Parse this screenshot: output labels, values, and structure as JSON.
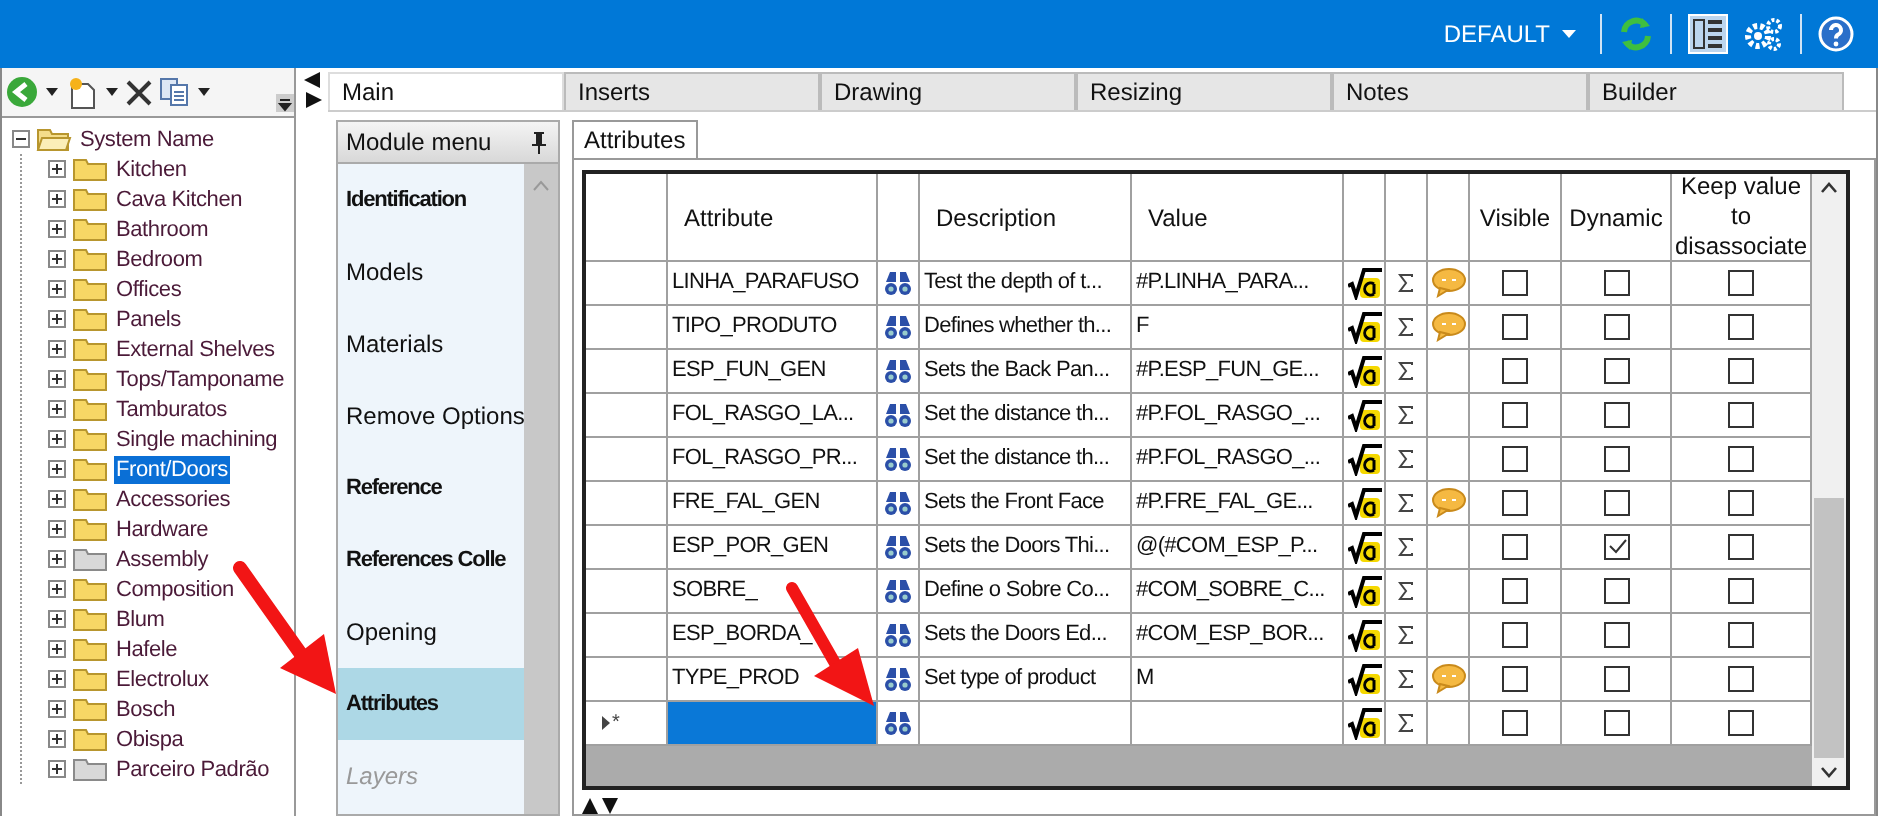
{
  "top_bar": {
    "profile": "DEFAULT"
  },
  "tree": {
    "label": "System Name",
    "expanded": true,
    "children": [
      {
        "label": "Kitchen",
        "kind": "folder",
        "selected": false
      },
      {
        "label": "Cava Kitchen",
        "kind": "folder",
        "selected": false
      },
      {
        "label": "Bathroom",
        "kind": "folder",
        "selected": false
      },
      {
        "label": "Bedroom",
        "kind": "folder",
        "selected": false
      },
      {
        "label": "Offices",
        "kind": "folder",
        "selected": false
      },
      {
        "label": "Panels",
        "kind": "folder",
        "selected": false
      },
      {
        "label": "External Shelves",
        "kind": "folder",
        "selected": false
      },
      {
        "label": "Tops/Tamponame",
        "kind": "folder",
        "selected": false
      },
      {
        "label": "Tamburatos",
        "kind": "folder",
        "selected": false
      },
      {
        "label": "Single machining",
        "kind": "folder",
        "selected": false
      },
      {
        "label": "Front/Doors",
        "kind": "folder",
        "selected": true
      },
      {
        "label": "Accessories",
        "kind": "folder",
        "selected": false
      },
      {
        "label": "Hardware",
        "kind": "folder",
        "selected": false
      },
      {
        "label": "Assembly",
        "kind": "grey",
        "selected": false
      },
      {
        "label": "Composition",
        "kind": "folder",
        "selected": false
      },
      {
        "label": "Blum",
        "kind": "folder",
        "selected": false
      },
      {
        "label": "Hafele",
        "kind": "folder",
        "selected": false
      },
      {
        "label": "Electrolux",
        "kind": "folder",
        "selected": false
      },
      {
        "label": "Bosch",
        "kind": "folder",
        "selected": false
      },
      {
        "label": "Obispa",
        "kind": "folder",
        "selected": false
      },
      {
        "label": "Parceiro Padrão",
        "kind": "grey",
        "selected": false
      }
    ]
  },
  "tabs": [
    {
      "label": "Main",
      "selected": true
    },
    {
      "label": "Inserts",
      "selected": false
    },
    {
      "label": "Drawing",
      "selected": false
    },
    {
      "label": "Resizing",
      "selected": false
    },
    {
      "label": "Notes",
      "selected": false
    },
    {
      "label": "Builder",
      "selected": false
    }
  ],
  "module_menu": {
    "title": "Module menu",
    "items": [
      {
        "label": "Identification",
        "bold": true,
        "selected": false,
        "disabled": false
      },
      {
        "label": "Models",
        "bold": false,
        "selected": false,
        "disabled": false
      },
      {
        "label": "Materials",
        "bold": false,
        "selected": false,
        "disabled": false
      },
      {
        "label": "Remove Options",
        "bold": false,
        "selected": false,
        "disabled": false
      },
      {
        "label": "Reference",
        "bold": true,
        "selected": false,
        "disabled": false
      },
      {
        "label": "References Colle",
        "bold": true,
        "selected": false,
        "disabled": false
      },
      {
        "label": "Opening",
        "bold": false,
        "selected": false,
        "disabled": false
      },
      {
        "label": "Attributes",
        "bold": true,
        "selected": true,
        "disabled": false
      },
      {
        "label": "Layers",
        "bold": false,
        "selected": false,
        "disabled": true
      }
    ]
  },
  "sub_tab": {
    "label": "Attributes",
    "selected": true
  },
  "table": {
    "columns": [
      "Attribute",
      "Description",
      "Value",
      "Visible",
      "Dynamic",
      "Keep value to disassociate"
    ],
    "rows": [
      {
        "attribute": "LINHA_PARAFUSO",
        "description": "Test the depth of t...",
        "value": "#P.LINHA_PARA...",
        "comment": true,
        "visible": false,
        "dynamic": false,
        "keep": false
      },
      {
        "attribute": "TIPO_PRODUTO",
        "description": "Defines whether th...",
        "value": "F",
        "comment": true,
        "visible": false,
        "dynamic": false,
        "keep": false
      },
      {
        "attribute": "ESP_FUN_GEN",
        "description": "Sets the Back Pan...",
        "value": "#P.ESP_FUN_GE...",
        "comment": false,
        "visible": false,
        "dynamic": false,
        "keep": false
      },
      {
        "attribute": "FOL_RASGO_LA...",
        "description": "Set the distance th...",
        "value": "#P.FOL_RASGO_...",
        "comment": false,
        "visible": false,
        "dynamic": false,
        "keep": false
      },
      {
        "attribute": "FOL_RASGO_PR...",
        "description": "Set the distance th...",
        "value": "#P.FOL_RASGO_...",
        "comment": false,
        "visible": false,
        "dynamic": false,
        "keep": false
      },
      {
        "attribute": "FRE_FAL_GEN",
        "description": "Sets the Front Face",
        "value": "#P.FRE_FAL_GE...",
        "comment": true,
        "visible": false,
        "dynamic": false,
        "keep": false
      },
      {
        "attribute": "ESP_POR_GEN",
        "description": "Sets the Doors Thi...",
        "value": "@(#COM_ESP_P...",
        "comment": false,
        "visible": false,
        "dynamic": true,
        "keep": false
      },
      {
        "attribute": "SOBRE_",
        "description": "Define o Sobre Co...",
        "value": "#COM_SOBRE_C...",
        "comment": false,
        "visible": false,
        "dynamic": false,
        "keep": false
      },
      {
        "attribute": "ESP_BORDA_",
        "description": "Sets the Doors Ed...",
        "value": "#COM_ESP_BOR...",
        "comment": false,
        "visible": false,
        "dynamic": false,
        "keep": false
      },
      {
        "attribute": "TYPE_PROD",
        "description": "Set type of product",
        "value": "M",
        "comment": true,
        "visible": false,
        "dynamic": false,
        "keep": false
      }
    ],
    "new_row": {
      "marker": "*",
      "visible": false,
      "dynamic": false,
      "keep": false
    }
  }
}
